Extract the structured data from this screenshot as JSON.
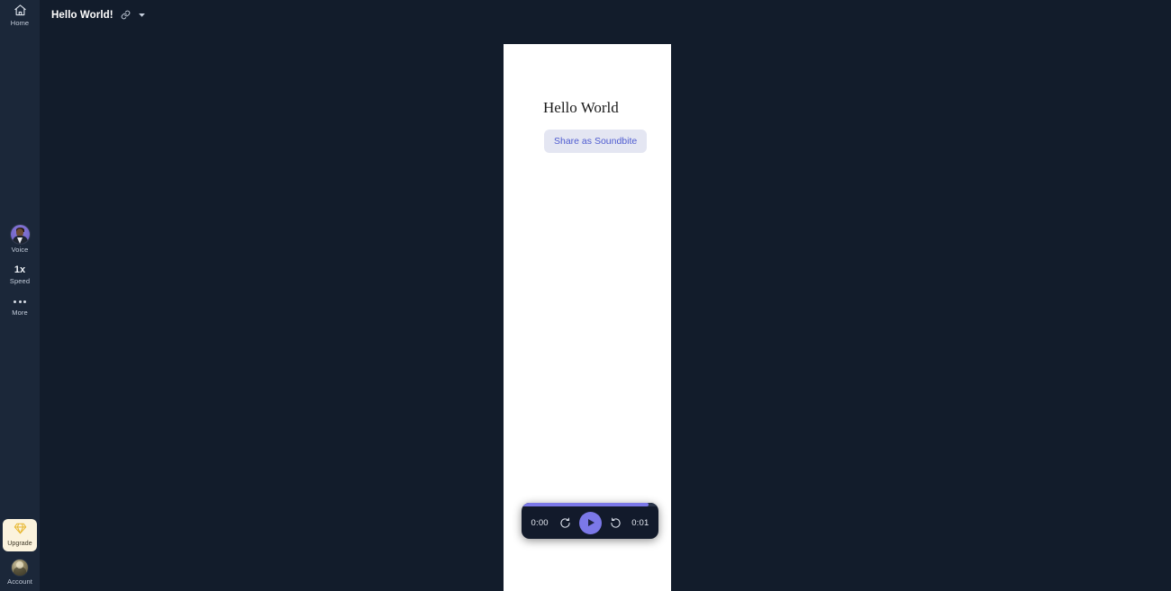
{
  "theme": {
    "app_background": "#121c2b",
    "sidebar_background": "#1b2739",
    "canvas_background": "#ffffff",
    "accent_purple": "#7b78e8",
    "upgrade_background": "#fbf3dd",
    "soundbite_button_background": "#e4e6f2",
    "soundbite_button_text": "#4e5bd0"
  },
  "sidebar": {
    "top": [
      {
        "label": "Home",
        "icon": "home-icon"
      }
    ],
    "middle": [
      {
        "label": "Voice",
        "icon": "voice-avatar-icon",
        "value": ""
      },
      {
        "label": "Speed",
        "icon": "speed-icon",
        "value": "1x"
      },
      {
        "label": "More",
        "icon": "more-dots-icon",
        "value": ""
      }
    ],
    "bottom": [
      {
        "label": "Upgrade",
        "icon": "diamond-icon"
      },
      {
        "label": "Account",
        "icon": "account-avatar-icon"
      }
    ]
  },
  "header": {
    "title": "Hello World!",
    "link_icon": "link-icon",
    "chevron_icon": "chevron-down-icon"
  },
  "document": {
    "heading": "Hello World",
    "share_button_label": "Share as Soundbite"
  },
  "player": {
    "current_time": "0:00",
    "total_time": "0:01",
    "rewind_label": "rewind-icon",
    "forward_label": "forward-icon",
    "play_label": "play-icon",
    "progress_percent": 93
  }
}
